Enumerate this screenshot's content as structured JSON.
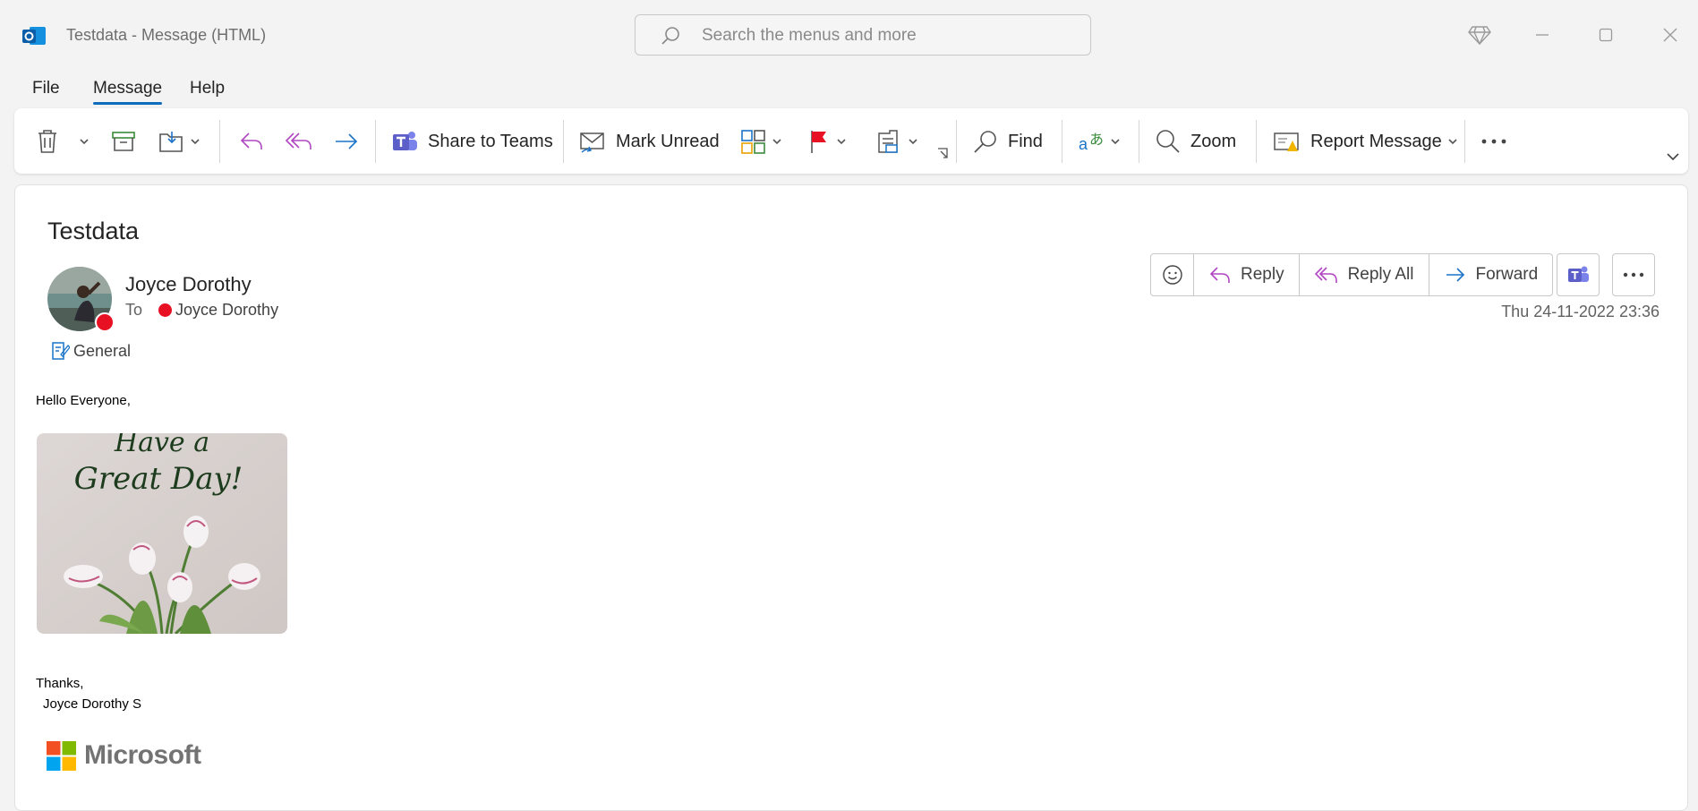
{
  "window": {
    "title": "Testdata  -  Message (HTML)",
    "search_placeholder": "Search the menus and more"
  },
  "menu": {
    "items": [
      {
        "label": "File"
      },
      {
        "label": "Message",
        "active": true
      },
      {
        "label": "Help"
      }
    ]
  },
  "ribbon": {
    "share_to_teams": "Share to Teams",
    "mark_unread": "Mark Unread",
    "find": "Find",
    "zoom": "Zoom",
    "report_message": "Report Message"
  },
  "message": {
    "subject": "Testdata",
    "sender": "Joyce Dorothy",
    "to_label": "To",
    "recipient": "Joyce Dorothy",
    "category": "General",
    "datetime": "Thu 24-11-2022 23:36",
    "actions": {
      "reply": "Reply",
      "reply_all": "Reply All",
      "forward": "Forward"
    },
    "body": {
      "greeting": "Hello Everyone,",
      "image_text_line1": "Have a",
      "image_text_line2": "Great Day!",
      "closing": "Thanks,",
      "signature_name": "Joyce Dorothy S",
      "logo_text": "Microsoft"
    }
  },
  "colors": {
    "accent": "#0f6cbd",
    "presence_busy": "#e81123",
    "teams_purple": "#5b5fc7",
    "reply_pink": "#b146c2"
  }
}
